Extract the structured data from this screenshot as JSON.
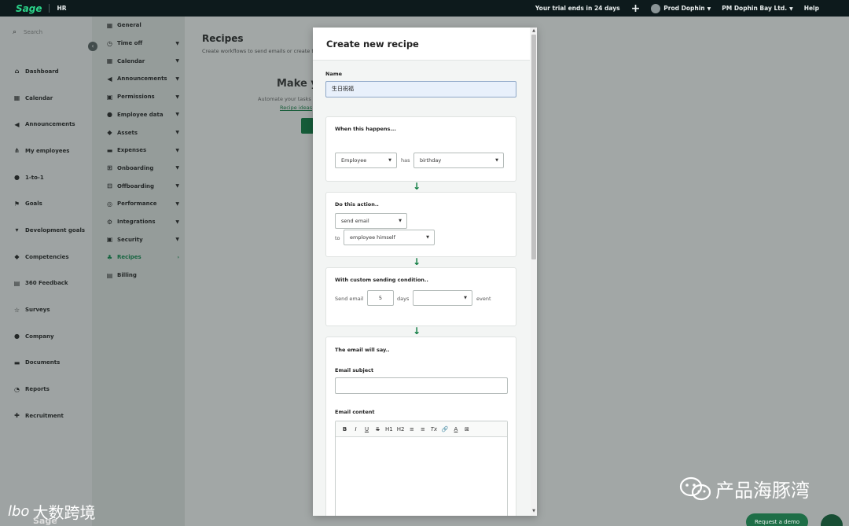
{
  "topbar": {
    "logo": "Sage",
    "module": "HR",
    "trial_text": "Your trial ends in 24 days",
    "add_icon": "plus-icon",
    "user_name": "Prod Dophin",
    "company": "PM Dophin Bay Ltd.",
    "help": "Help"
  },
  "sidebar": {
    "search_placeholder": "Search",
    "items": [
      {
        "label": "Dashboard",
        "icon": "home-icon"
      },
      {
        "label": "Calendar",
        "icon": "calendar-icon"
      },
      {
        "label": "Announcements",
        "icon": "megaphone-icon"
      },
      {
        "label": "My employees",
        "icon": "org-chart-icon"
      },
      {
        "label": "1-to-1",
        "icon": "chat-bubbles-icon"
      },
      {
        "label": "Goals",
        "icon": "flag-icon"
      },
      {
        "label": "Development goals",
        "icon": "trophy-icon"
      },
      {
        "label": "Competencies",
        "icon": "graduation-cap-icon"
      },
      {
        "label": "360 Feedback",
        "icon": "clipboard-icon"
      },
      {
        "label": "Surveys",
        "icon": "star-icon"
      },
      {
        "label": "Company",
        "icon": "people-icon"
      },
      {
        "label": "Documents",
        "icon": "folder-icon"
      },
      {
        "label": "Reports",
        "icon": "pie-chart-icon"
      },
      {
        "label": "Recruitment",
        "icon": "add-user-icon"
      }
    ]
  },
  "settings": {
    "items": [
      {
        "label": "General",
        "icon": "grid-icon",
        "has_arrow": false
      },
      {
        "label": "Time off",
        "icon": "clock-icon",
        "has_arrow": true
      },
      {
        "label": "Calendar",
        "icon": "calendar-icon",
        "has_arrow": true
      },
      {
        "label": "Announcements",
        "icon": "megaphone-icon",
        "has_arrow": true
      },
      {
        "label": "Permissions",
        "icon": "lock-icon",
        "has_arrow": true
      },
      {
        "label": "Employee data",
        "icon": "user-icon",
        "has_arrow": true
      },
      {
        "label": "Assets",
        "icon": "tag-icon",
        "has_arrow": true
      },
      {
        "label": "Expenses",
        "icon": "money-icon",
        "has_arrow": true
      },
      {
        "label": "Onboarding",
        "icon": "plus-square-icon",
        "has_arrow": true
      },
      {
        "label": "Offboarding",
        "icon": "minus-square-icon",
        "has_arrow": true
      },
      {
        "label": "Performance",
        "icon": "target-icon",
        "has_arrow": true
      },
      {
        "label": "Integrations",
        "icon": "cogs-icon",
        "has_arrow": true
      },
      {
        "label": "Security",
        "icon": "lock-icon",
        "has_arrow": true
      },
      {
        "label": "Recipes",
        "icon": "chef-hat-icon",
        "has_arrow": true,
        "active": true
      },
      {
        "label": "Billing",
        "icon": "billing-icon",
        "has_arrow": false
      }
    ]
  },
  "main": {
    "title": "Recipes",
    "subtitle": "Create workflows to send emails or create ta",
    "make_title": "Make yo",
    "automate_text": "Automate your tasks",
    "recipe_link": "Recipe ideas"
  },
  "modal": {
    "title": "Create new recipe",
    "name_label": "Name",
    "name_value": "生日祝福",
    "trigger": {
      "title": "When this happens...",
      "subject": "Employee",
      "has_word": "has",
      "event": "birthday"
    },
    "action": {
      "title": "Do this action..",
      "action_value": "send email",
      "to_word": "to",
      "recipient": "employee himself"
    },
    "condition": {
      "title": "With custom sending condition..",
      "send_label": "Send email",
      "days_value": "5",
      "days_word": "days",
      "timing_value": "",
      "event_word": "event"
    },
    "email": {
      "title": "The email will say..",
      "subject_label": "Email subject",
      "subject_value": "",
      "content_label": "Email content",
      "toolbar": [
        "B",
        "I",
        "U",
        "S",
        "H1",
        "H2",
        "≡",
        "≡",
        "Tx",
        "🔗",
        "A",
        "⊠"
      ]
    }
  },
  "watermarks": {
    "right_text": "产品海豚湾",
    "left_text": "大数跨境",
    "left_logo": "lbo",
    "bottom_logo": "Sage"
  },
  "footer": {
    "demo_button": "Request a demo"
  },
  "colors": {
    "brand_green": "#0a7a3e",
    "topbar_bg": "#0d1a1c",
    "logo_green": "#2bd48a"
  }
}
